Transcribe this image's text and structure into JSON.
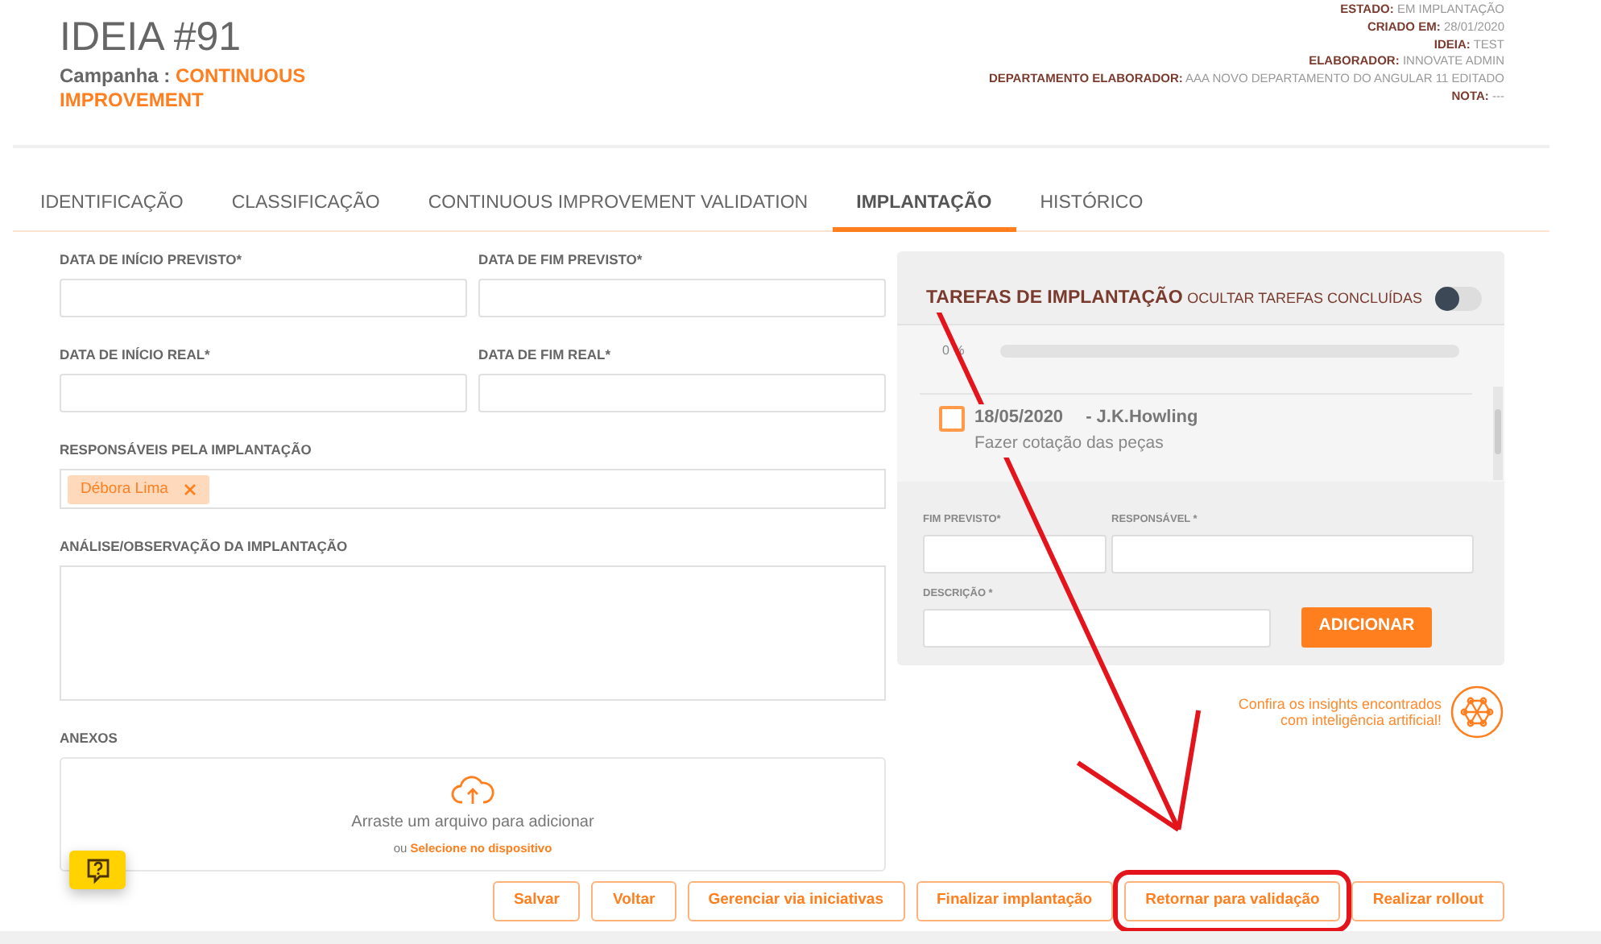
{
  "title": "IDEIA #91",
  "campaign": {
    "label": "Campanha :",
    "value": "CONTINUOUS IMPROVEMENT"
  },
  "details": [
    {
      "label": "ESTADO:",
      "value": "EM IMPLANTAÇÃO"
    },
    {
      "label": "CRIADO EM:",
      "value": "28/01/2020"
    },
    {
      "label": "IDEIA:",
      "value": "TEST"
    },
    {
      "label": "ELABORADOR:",
      "value": "INNOVATE ADMIN"
    },
    {
      "label": "DEPARTAMENTO ELABORADOR:",
      "value": "AAA NOVO DEPARTAMENTO DO ANGULAR 11 EDITADO"
    },
    {
      "label": "NOTA:",
      "value": "---"
    }
  ],
  "tabs": [
    {
      "label": "IDENTIFICAÇÃO",
      "selected": false
    },
    {
      "label": "CLASSIFICAÇÃO",
      "selected": false
    },
    {
      "label": "CONTINUOUS IMPROVEMENT VALIDATION",
      "selected": false
    },
    {
      "label": "IMPLANTAÇÃO",
      "selected": true
    },
    {
      "label": "HISTÓRICO",
      "selected": false
    }
  ],
  "date_fields": [
    {
      "label": "DATA DE INÍCIO PREVISTO*"
    },
    {
      "label": "DATA DE FIM PREVISTO*"
    },
    {
      "label": "DATA DE INÍCIO REAL*"
    },
    {
      "label": "DATA DE FIM REAL*"
    }
  ],
  "responsibles": {
    "label": "RESPONSÁVEIS PELA IMPLANTAÇÃO",
    "tags": [
      {
        "label": "Débora Lima"
      }
    ]
  },
  "analysis": {
    "label": "ANÁLISE/OBSERVAÇÃO DA IMPLANTAÇÃO"
  },
  "attachments": {
    "label": "ANEXOS",
    "prompt": "Arraste um arquivo para adicionar",
    "prefix": "ou",
    "link": "Selecione no dispositivo"
  },
  "tasks_panel": {
    "title": "TAREFAS DE IMPLANTAÇÃO",
    "toggle": {
      "label": "OCULTAR TAREFAS CONCLUÍDAS",
      "on": false
    },
    "progress": {
      "reading": "0 %",
      "level": 0
    },
    "tasks": [
      {
        "date": "18/05/2020",
        "owner": "- J.K.Howling",
        "description": "Fazer cotação das peças",
        "checked": false
      }
    ],
    "new_task": {
      "fields": [
        {
          "label": "FIM PREVISTO*"
        },
        {
          "label": "RESPONSÁVEL *"
        },
        {
          "label": "DESCRIÇÃO *"
        }
      ],
      "button": "ADICIONAR"
    }
  },
  "insights": {
    "lines": [
      "Confira os insights encontrados",
      "com inteligência artificial!"
    ]
  },
  "actions": [
    {
      "label": "Salvar",
      "highlighted": false
    },
    {
      "label": "Voltar",
      "highlighted": false
    },
    {
      "label": "Gerenciar via iniciativas",
      "highlighted": false
    },
    {
      "label": "Finalizar implantação",
      "highlighted": false
    },
    {
      "label": "Retornar para validação",
      "highlighted": true
    },
    {
      "label": "Realizar rollout",
      "highlighted": false
    }
  ]
}
